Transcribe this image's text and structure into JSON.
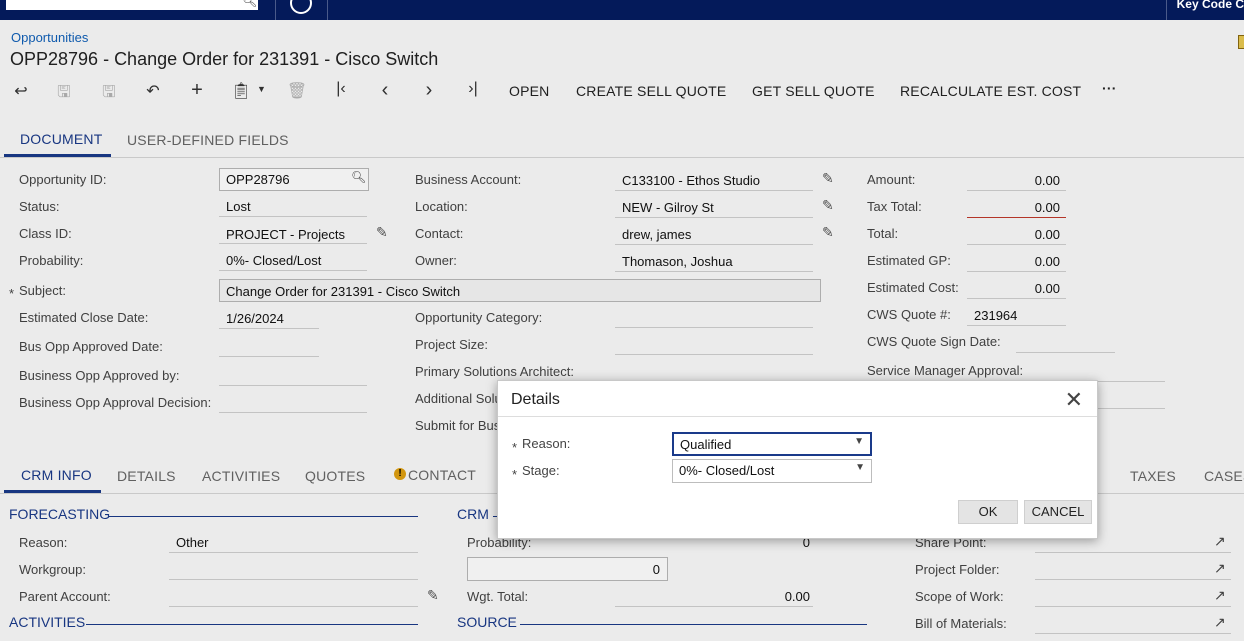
{
  "topbar": {
    "key_code_label": "Key Code C"
  },
  "breadcrumb": "Opportunities",
  "page_title": "OPP28796 - Change Order for 231391 - Cisco Switch",
  "toolbar": {
    "open": "OPEN",
    "create_sell_quote": "CREATE SELL QUOTE",
    "get_sell_quote": "GET SELL QUOTE",
    "recalculate": "RECALCULATE EST. COST",
    "more": "···"
  },
  "tabs": {
    "document": "DOCUMENT",
    "user_defined": "USER-DEFINED FIELDS"
  },
  "form": {
    "opportunity_id_label": "Opportunity ID:",
    "opportunity_id": "OPP28796",
    "status_label": "Status:",
    "status": "Lost",
    "class_id_label": "Class ID:",
    "class_id": "PROJECT - Projects",
    "probability_label": "Probability:",
    "probability": "0%- Closed/Lost",
    "subject_label": "Subject:",
    "subject": "Change Order for 231391 - Cisco Switch",
    "est_close_label": "Estimated Close Date:",
    "est_close": "1/26/2024",
    "bus_opp_approved_date_label": "Bus Opp Approved Date:",
    "bus_opp_approved_by_label": "Business Opp Approved by:",
    "bus_opp_decision_label": "Business Opp Approval Decision:",
    "business_account_label": "Business Account:",
    "business_account": "C133100 - Ethos Studio",
    "location_label": "Location:",
    "location": "NEW - Gilroy St",
    "contact_label": "Contact:",
    "contact": "drew, james",
    "owner_label": "Owner:",
    "owner": "Thomason, Joshua",
    "opp_category_label": "Opportunity Category:",
    "project_size_label": "Project Size:",
    "primary_sa_label": "Primary Solutions Architect:",
    "additional_sol_label": "Additional Solu",
    "submit_for_label": "Submit for Bus",
    "amount_label": "Amount:",
    "amount": "0.00",
    "tax_total_label": "Tax Total:",
    "tax_total": "0.00",
    "total_label": "Total:",
    "total": "0.00",
    "est_gp_label": "Estimated GP:",
    "est_gp": "0.00",
    "est_cost_label": "Estimated Cost:",
    "est_cost": "0.00",
    "cws_quote_label": "CWS Quote #:",
    "cws_quote": "231964",
    "cws_sign_label": "CWS Quote Sign Date:",
    "svc_mgr_label": "Service Manager Approval:"
  },
  "lower_tabs": {
    "crm_info": "CRM INFO",
    "details": "DETAILS",
    "activities": "ACTIVITIES",
    "quotes": "QUOTES",
    "contact": "CONTACT",
    "taxes": "TAXES",
    "cases": "CASES"
  },
  "forecasting": {
    "title": "FORECASTING",
    "reason_label": "Reason:",
    "reason": "Other",
    "workgroup_label": "Workgroup:",
    "parent_account_label": "Parent Account:"
  },
  "activities_section": {
    "title": "ACTIVITIES"
  },
  "crm": {
    "title": "CRM",
    "probability_label": "Probability:",
    "probability": "0",
    "probability_box": "0",
    "wgt_total_label": "Wgt. Total:",
    "wgt_total": "0.00"
  },
  "source_section": {
    "title": "SOURCE"
  },
  "links": {
    "share_point_label": "Share Point:",
    "project_folder_label": "Project Folder:",
    "scope_of_work_label": "Scope of Work:",
    "bill_of_materials_label": "Bill of Materials:"
  },
  "dialog": {
    "title": "Details",
    "reason_label": "Reason:",
    "reason_value": "Qualified",
    "stage_label": "Stage:",
    "stage_value": "0%- Closed/Lost",
    "ok": "OK",
    "cancel": "CANCEL"
  },
  "colors": {
    "accent": "#1a3a8a",
    "topbar": "#041a5a",
    "link": "#1060b8"
  }
}
